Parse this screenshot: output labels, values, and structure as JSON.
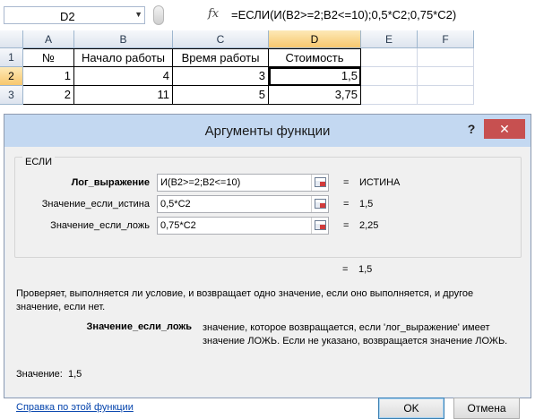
{
  "formula_bar": {
    "name_box": "D2",
    "fx_label": "fx",
    "formula": "=ЕСЛИ(И(B2>=2;B2<=10);0,5*C2;0,75*C2)"
  },
  "sheet": {
    "columns": [
      "A",
      "B",
      "C",
      "D",
      "E",
      "F"
    ],
    "rows": [
      "1",
      "2",
      "3"
    ],
    "header_row": [
      "№",
      "Начало работы",
      "Время работы",
      "Стоимость"
    ],
    "data_rows": [
      [
        "1",
        "4",
        "3",
        "1,5"
      ],
      [
        "2",
        "11",
        "5",
        "3,75"
      ]
    ],
    "active_cell": "D2"
  },
  "dialog": {
    "title": "Аргументы функции",
    "help": "?",
    "close": "✕",
    "function_name": "ЕСЛИ",
    "args": [
      {
        "label": "Лог_выражение",
        "value": "И(B2>=2;B2<=10)",
        "equals": "=",
        "result": "ИСТИНА"
      },
      {
        "label": "Значение_если_истина",
        "value": "0,5*C2",
        "equals": "=",
        "result": "1,5"
      },
      {
        "label": "Значение_если_ложь",
        "value": "0,75*C2",
        "equals": "=",
        "result": "2,25"
      }
    ],
    "total_equals": "=",
    "total_result": "1,5",
    "description": "Проверяет, выполняется ли условие, и возвращает одно значение, если оно выполняется, и другое значение, если нет.",
    "current_arg_name": "Значение_если_ложь",
    "current_arg_desc": "значение, которое возвращается, если 'лог_выражение' имеет значение ЛОЖЬ. Если не указано, возвращается значение ЛОЖЬ.",
    "value_label": "Значение:",
    "value": "1,5",
    "help_link": "Справка по этой функции",
    "ok": "OK",
    "cancel": "Отмена"
  },
  "colors": {
    "title_bar": "#c3d8f1",
    "close_button": "#c75050",
    "selected_header": "#f7c76e",
    "link": "#0645ad"
  }
}
